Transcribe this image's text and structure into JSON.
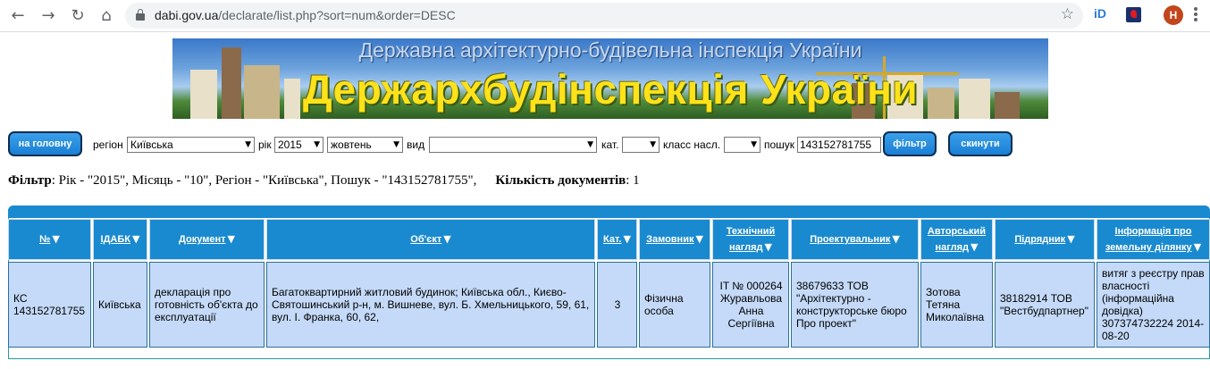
{
  "browser": {
    "url_host": "dabi.gov.ua",
    "url_path": "/declarate/list.php?sort=num&order=DESC",
    "back_icon": "arrow-left-icon",
    "forward_icon": "arrow-right-icon",
    "reload_icon": "reload-icon",
    "home_icon": "home-icon",
    "extension_label": "iD",
    "profile_initial": "H"
  },
  "banner": {
    "subtitle": "Державна архітектурно-будівельна інспекція України",
    "title": "Держархбудінспекція України"
  },
  "form": {
    "home_button": "на головну",
    "region_label": "регіон",
    "region_value": "Київська",
    "year_label": "рік",
    "year_value": "2015",
    "month_value": "жовтень",
    "kind_label": "вид",
    "kind_value": "",
    "cat_label": "кат.",
    "cat_value": "",
    "class_label": "класс насл.",
    "class_value": "",
    "search_label": "пошук",
    "search_value": "143152781755",
    "filter_button": "фільтр",
    "reset_button": "скинути"
  },
  "summary": {
    "filter_label": "Фільтр",
    "filter_text": ": Рік - \"2015\", Місяць - \"10\", Регіон - \"Київська\", Пошук - \"143152781755\",",
    "count_label": "Кількість документів",
    "count_text": ": 1"
  },
  "table": {
    "headers": [
      {
        "line1": "№",
        "line2": ""
      },
      {
        "line1": "ІДАБК",
        "line2": ""
      },
      {
        "line1": "Документ",
        "line2": ""
      },
      {
        "line1": "Об'єкт",
        "line2": ""
      },
      {
        "line1": "Кат.",
        "line2": ""
      },
      {
        "line1": "Замовник",
        "line2": ""
      },
      {
        "line1": "Технічний",
        "line2": "нагляд"
      },
      {
        "line1": "Проектувальник",
        "line2": ""
      },
      {
        "line1": "Авторський",
        "line2": "нагляд"
      },
      {
        "line1": "Підрядник",
        "line2": ""
      },
      {
        "line1": "Інформація про",
        "line2": "земельну ділянку"
      }
    ],
    "sort_icon": "▼",
    "rows": [
      {
        "num": "КС 143152781755",
        "idabk": "Київська",
        "document": "декларація про готовність об'єкта до експлуатації",
        "object": "Багатоквартирний житловий будинок; Київська обл., Києво-Святошинський р-н, м. Вишневе, вул. Б. Хмельницького, 59, 61, вул. І. Франка, 60, 62,",
        "cat": "3",
        "customer": "Фізична особа",
        "tech_supervision": "IT № 000264 Журавльова Анна Сергіївна",
        "designer": "38679633 ТОВ \"Архітектурно - конструкторське бюро Про проект\"",
        "author_supervision": "Зотова Тетяна Миколаївна",
        "contractor": "38182914 ТОВ \"Вестбудпартнер\"",
        "land_info": "витяг з реєстру прав власності (інформаційна довідка) 307374732224 2014-08-20"
      }
    ]
  }
}
